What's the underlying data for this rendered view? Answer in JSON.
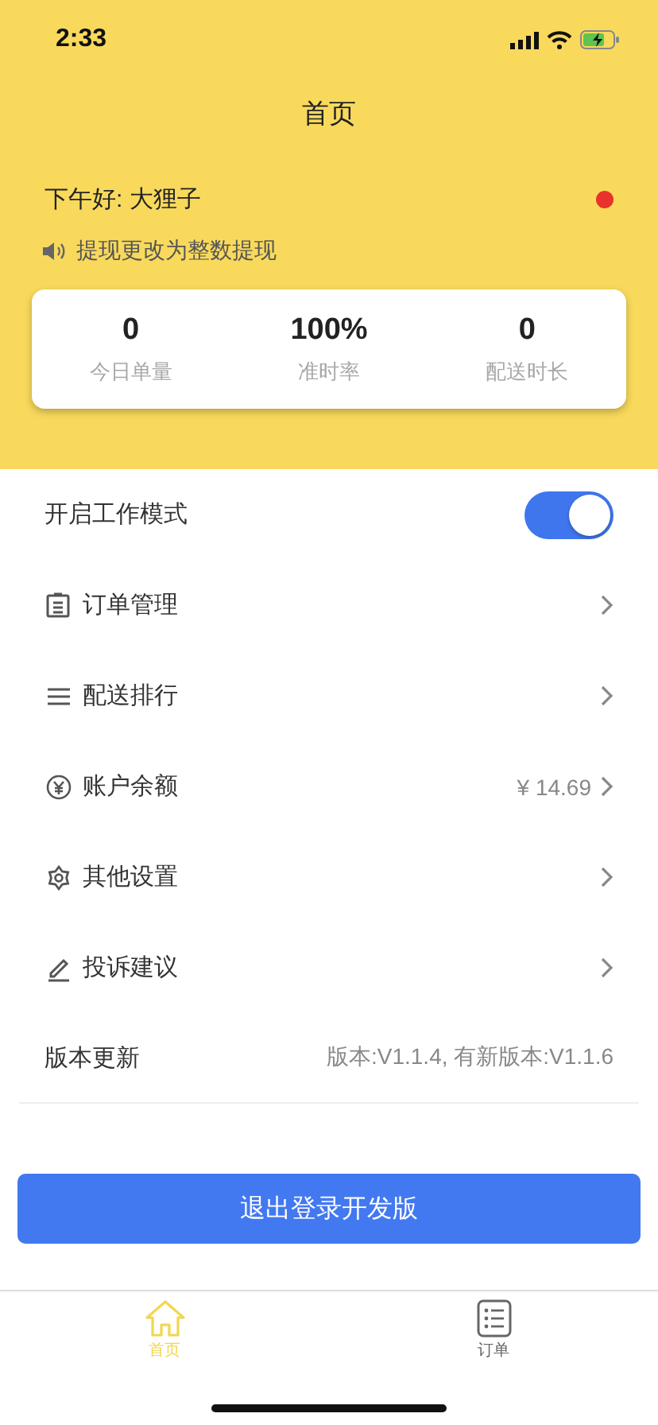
{
  "status_bar": {
    "time": "2:33"
  },
  "header": {
    "title": "首页",
    "greeting": "下午好: 大狸子",
    "notification_dot": true,
    "notice": "提现更改为整数提现"
  },
  "stats": [
    {
      "value": "0",
      "label": "今日单量"
    },
    {
      "value": "100%",
      "label": "准时率"
    },
    {
      "value": "0",
      "label": "配送时长"
    }
  ],
  "menu": [
    {
      "kind": "toggle",
      "label": "开启工作模式",
      "on": true
    },
    {
      "kind": "link",
      "label": "订单管理"
    },
    {
      "kind": "link",
      "label": "配送排行"
    },
    {
      "kind": "link",
      "label": "账户余额",
      "value": "¥ 14.69"
    },
    {
      "kind": "link",
      "label": "其他设置"
    },
    {
      "kind": "link",
      "label": "投诉建议"
    },
    {
      "kind": "info",
      "label": "版本更新",
      "value": "版本:V1.1.4, 有新版本:V1.1.6"
    }
  ],
  "logout_button": "退出登录开发版",
  "tab_bar": [
    {
      "label": "首页",
      "selected": true
    },
    {
      "label": "订单",
      "selected": false
    }
  ]
}
